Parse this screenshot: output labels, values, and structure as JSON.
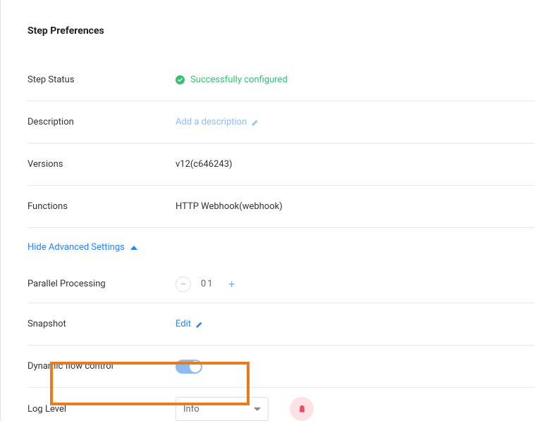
{
  "title": "Step Preferences",
  "rows": {
    "status": {
      "label": "Step Status",
      "value": "Successfully configured"
    },
    "description": {
      "label": "Description",
      "placeholder": "Add a description"
    },
    "versions": {
      "label": "Versions",
      "value": "v12(c646243)"
    },
    "functions": {
      "label": "Functions",
      "value": "HTTP Webhook(webhook)"
    }
  },
  "advanced": {
    "toggle_label": "Hide Advanced Settings",
    "parallel": {
      "label": "Parallel Processing",
      "value": "01"
    },
    "snapshot": {
      "label": "Snapshot",
      "action": "Edit"
    },
    "dynamic": {
      "label": "Dynamic flow control",
      "enabled": true
    },
    "loglevel": {
      "label": "Log Level",
      "selected": "Info"
    }
  }
}
